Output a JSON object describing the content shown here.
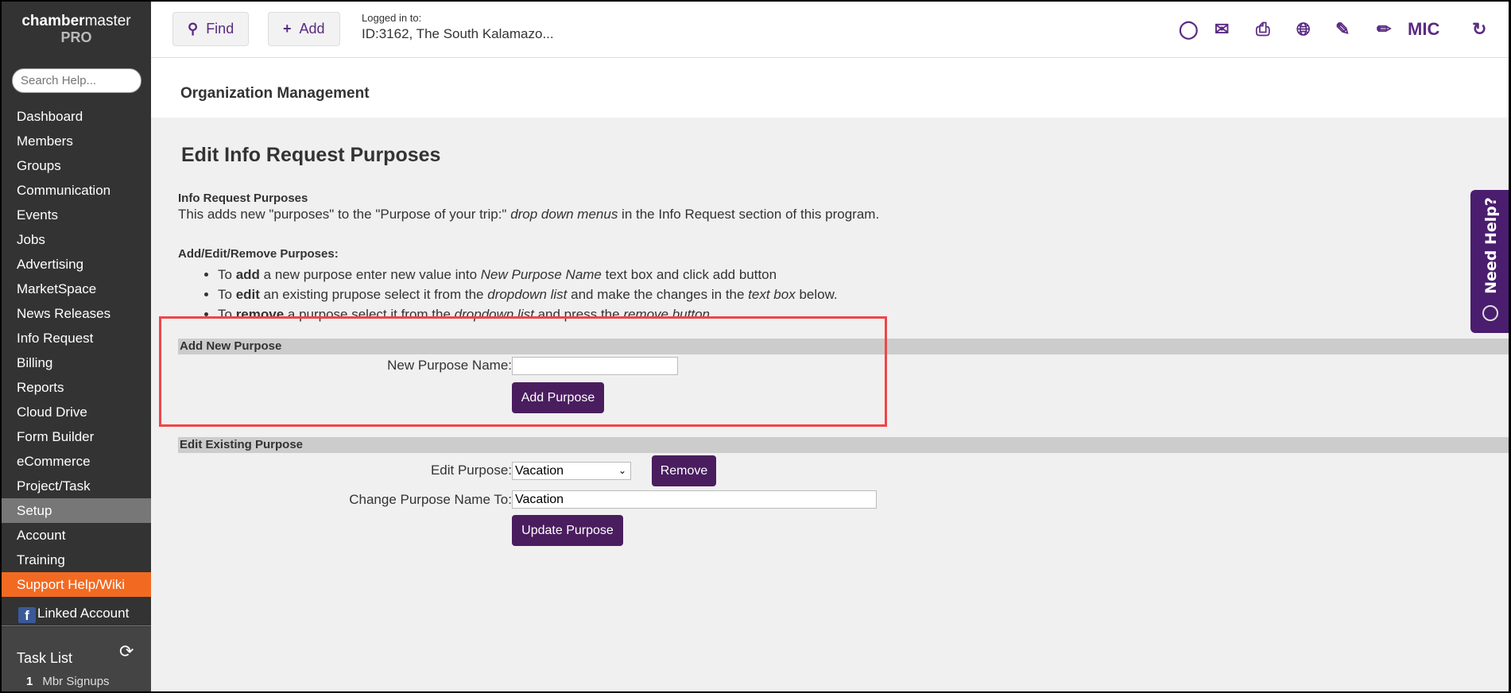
{
  "sidebar": {
    "logo_bold": "chamber",
    "logo_rest": "master",
    "logo_sub": "PRO",
    "search_placeholder": "Search Help...",
    "items": [
      "Dashboard",
      "Members",
      "Groups",
      "Communication",
      "Events",
      "Jobs",
      "Advertising",
      "MarketSpace",
      "News Releases",
      "Info Request",
      "Billing",
      "Reports",
      "Cloud Drive",
      "Form Builder",
      "eCommerce",
      "Project/Task",
      "Setup",
      "Account",
      "Training",
      "Support Help/Wiki"
    ],
    "active": "Setup",
    "linked_account": "Linked Account",
    "task_list": {
      "title": "Task List",
      "rows": [
        {
          "count": "1",
          "label": "Mbr Signups"
        }
      ]
    }
  },
  "topbar": {
    "find": "Find",
    "add": "Add",
    "logged_label": "Logged in to:",
    "logged_value": "ID:3162, The South Kalamazo...",
    "mic": "MIC"
  },
  "org_title": "Organization Management",
  "page": {
    "title": "Edit Info Request Purposes",
    "section1_title": "Info Request Purposes",
    "desc_a": "This adds new \"purposes\" to the \"Purpose of your trip:\" ",
    "desc_em": "drop down menus",
    "desc_b": " in the Info Request section of this program.",
    "section2_title": "Add/Edit/Remove Purposes:",
    "bullets": [
      {
        "a": "To ",
        "b": "add",
        "c": " a new purpose enter new value into ",
        "em": "New Purpose Name",
        "d": " text box and click add button",
        "em2": "",
        "e": ""
      },
      {
        "a": "To ",
        "b": "edit",
        "c": " an existing prupose select it from the ",
        "em": "dropdown list",
        "d": " and make the changes in the ",
        "em2": "text box",
        "e": " below."
      },
      {
        "a": "To ",
        "b": "remove",
        "c": " a purpose select it from the ",
        "em": "dropdown list",
        "d": " and press the ",
        "em2": "remove button",
        "e": ""
      }
    ],
    "add_section": {
      "header": "Add New Purpose",
      "label": "New Purpose Name:",
      "value": "",
      "button": "Add Purpose"
    },
    "edit_section": {
      "header": "Edit Existing Purpose",
      "select_label": "Edit Purpose:",
      "selected": "Vacation",
      "remove": "Remove",
      "rename_label": "Change Purpose Name To:",
      "rename_value": "Vacation",
      "button": "Update Purpose"
    }
  },
  "help_tab": "Need Help?",
  "colors": {
    "accent": "#4a1d5f",
    "support": "#f26a21",
    "highlight": "#f0454a"
  }
}
